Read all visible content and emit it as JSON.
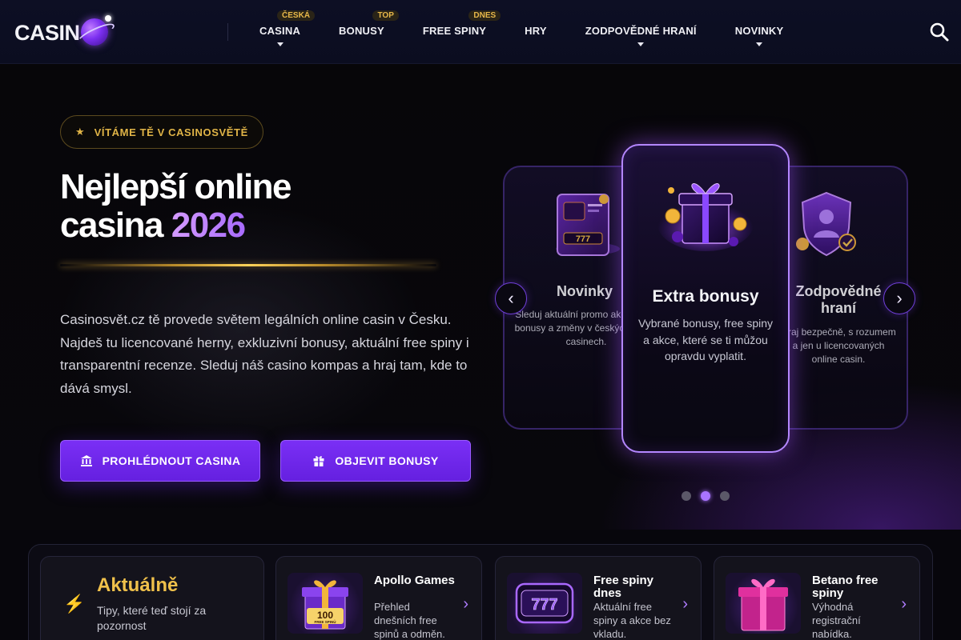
{
  "header": {
    "logo_text": "CASIN",
    "nav": [
      {
        "label": "CASINA",
        "badge": "ČESKÁ",
        "caret": true
      },
      {
        "label": "BONUSY",
        "badge": "TOP",
        "caret": false
      },
      {
        "label": "FREE SPINY",
        "badge": "DNES",
        "caret": false
      },
      {
        "label": "HRY",
        "badge": "",
        "caret": false
      },
      {
        "label": "ZODPOVĚDNÉ HRANÍ",
        "badge": "",
        "caret": true
      },
      {
        "label": "NOVINKY",
        "badge": "",
        "caret": true
      }
    ]
  },
  "hero": {
    "welcome_star": "★",
    "welcome_text": "VÍTÁME TĚ V CASINOSVĚTĚ",
    "title_line1": "Nejlepší online",
    "title_line2": "casina",
    "title_year": "2026",
    "description": "Casinosvět.cz tě provede světem legálních online casin v Česku. Najdeš tu licencované herny, exkluzivní bonusy, aktuální free spiny i transparentní recenze. Sleduj náš casino kompas a hraj tam, kde to dává smysl.",
    "btn_casinos": "PROHLÉDNOUT CASINA",
    "btn_bonus": "OBJEVIT BONUSY"
  },
  "carousel": {
    "prev": "‹",
    "next": "›",
    "active_index": 1,
    "cards": [
      {
        "title": "Novinky",
        "text": "Sleduj aktuální promo akce, nové bonusy a změny v českých online casinech."
      },
      {
        "title": "Extra bonusy",
        "text": "Vybrané bonusy, free spiny a akce, které se ti můžou opravdu vyplatit."
      },
      {
        "title": "Zodpovědné hraní",
        "text": "Hraj bezpečně, s rozumem a jen u licencovaných online casin."
      }
    ]
  },
  "strip": {
    "news_title": "Aktuálně",
    "news_sub": "Tipy, které teď stojí za pozornost",
    "news_icon": "⚡",
    "promos": [
      {
        "title": "Apollo Games",
        "desc": "Přehled dnešních free spinů a odměn.",
        "thumb_text": "100",
        "thumb_sub": "FREE SPINŮ"
      },
      {
        "title": "Free spiny dnes",
        "desc": "Aktuální free spiny a akce bez vkladu.",
        "thumb_text": "777",
        "thumb_sub": ""
      },
      {
        "title": "Betano free spiny",
        "desc": "Výhodná registrační nabídka.",
        "thumb_text": "",
        "thumb_sub": ""
      }
    ],
    "chevron": "›"
  },
  "colors": {
    "accent_purple": "#7a2ff5",
    "gold": "#e0b447",
    "header_bg": "#0d0f24"
  }
}
